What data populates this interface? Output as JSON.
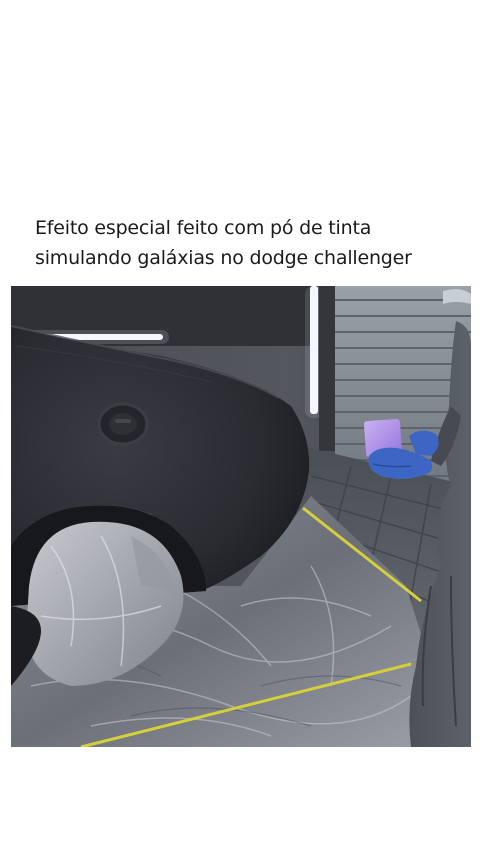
{
  "post": {
    "caption_line1": "Efeito especial feito com pó de tinta",
    "caption_line2": "simulando galáxias no dodge challenger"
  },
  "photo": {
    "subject": "dodge-challenger-rear-fender-being-painted",
    "colors": {
      "car_body": "#2b2c33",
      "plastic_sheet": "#7c808a",
      "masking_tape": "#d6cf3a",
      "paint_swatch": "#b394e8",
      "glove": "#3d66c4",
      "led_strip": "#f2f6ff"
    }
  }
}
